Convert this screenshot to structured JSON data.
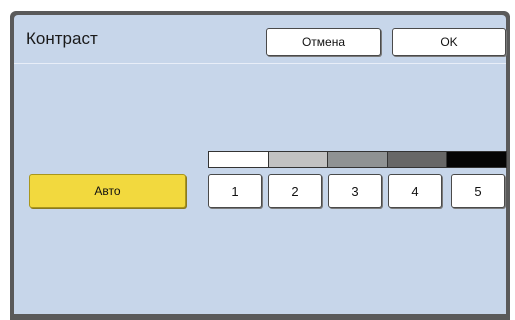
{
  "dialog": {
    "title": "Контраст",
    "cancel_label": "Отмена",
    "ok_label": "OK"
  },
  "auto_label": "Авто",
  "levels": [
    {
      "label": "1",
      "color": "#ffffff"
    },
    {
      "label": "2",
      "color": "#c2c2c2"
    },
    {
      "label": "3",
      "color": "#8f9293"
    },
    {
      "label": "4",
      "color": "#676767"
    },
    {
      "label": "5",
      "color": "#050505"
    }
  ]
}
